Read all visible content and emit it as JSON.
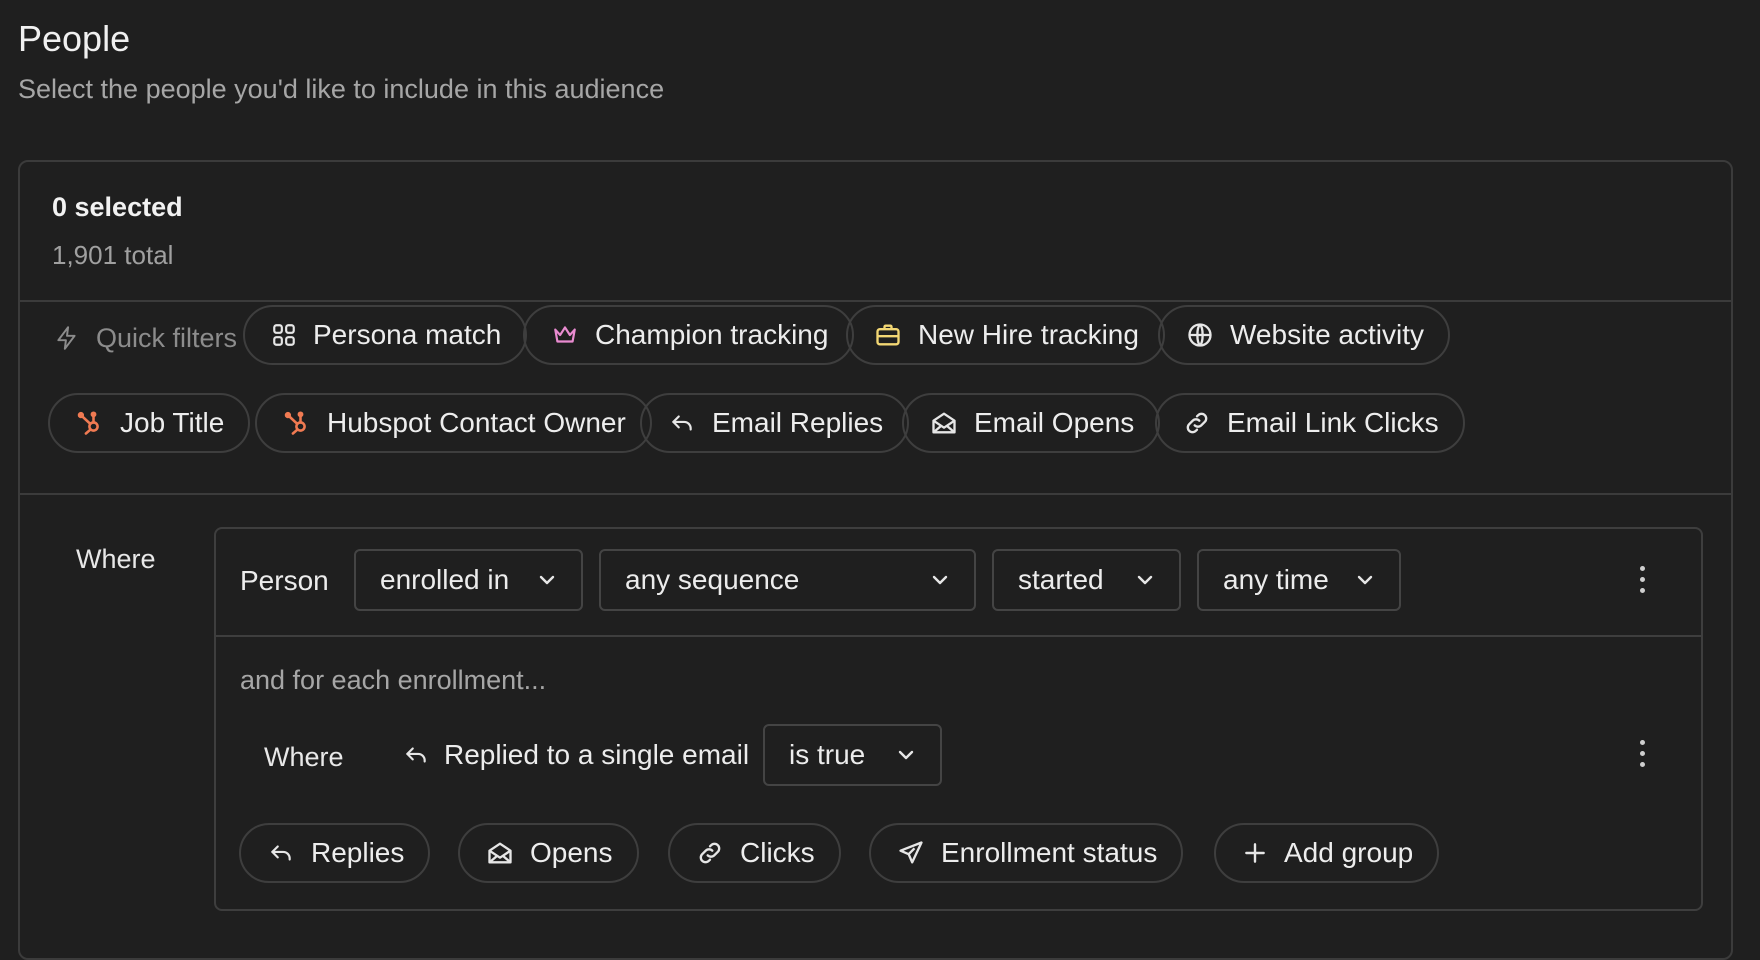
{
  "header": {
    "title": "People",
    "subtitle": "Select the people you'd like to include in this audience"
  },
  "selection": {
    "selected": "0 selected",
    "total": "1,901 total"
  },
  "quick_filters": {
    "label": "Quick filters",
    "chips": [
      {
        "label": "Persona match",
        "icon": "grid-icon"
      },
      {
        "label": "Champion tracking",
        "icon": "crown-icon",
        "icon_color": "#e98bd0"
      },
      {
        "label": "New Hire tracking",
        "icon": "briefcase-icon",
        "icon_color": "#f3d774"
      },
      {
        "label": "Website activity",
        "icon": "globe-icon"
      },
      {
        "label": "Job Title",
        "icon": "hubspot-icon",
        "icon_color": "#f07a52"
      },
      {
        "label": "Hubspot Contact Owner",
        "icon": "hubspot-icon",
        "icon_color": "#f07a52"
      },
      {
        "label": "Email Replies",
        "icon": "reply-icon"
      },
      {
        "label": "Email Opens",
        "icon": "envelope-open-icon"
      },
      {
        "label": "Email Link Clicks",
        "icon": "link-icon"
      }
    ]
  },
  "rule": {
    "where_label": "Where",
    "subject": "Person",
    "dropdowns": [
      "enrolled in",
      "any sequence",
      "started",
      "any time"
    ],
    "each_label": "and for each enrollment...",
    "sub_where_label": "Where",
    "condition": "Replied to a single email",
    "condition_value": "is true",
    "add_chips": [
      {
        "label": "Replies",
        "icon": "reply-icon"
      },
      {
        "label": "Opens",
        "icon": "envelope-open-icon"
      },
      {
        "label": "Clicks",
        "icon": "link-icon"
      },
      {
        "label": "Enrollment status",
        "icon": "send-icon"
      },
      {
        "label": "Add group",
        "icon": "plus-icon"
      }
    ]
  },
  "colors": {
    "background": "#1f1f1f",
    "border": "#3e3e3e",
    "hubspot": "#f07a52",
    "crown": "#e98bd0",
    "briefcase": "#f3d774"
  }
}
